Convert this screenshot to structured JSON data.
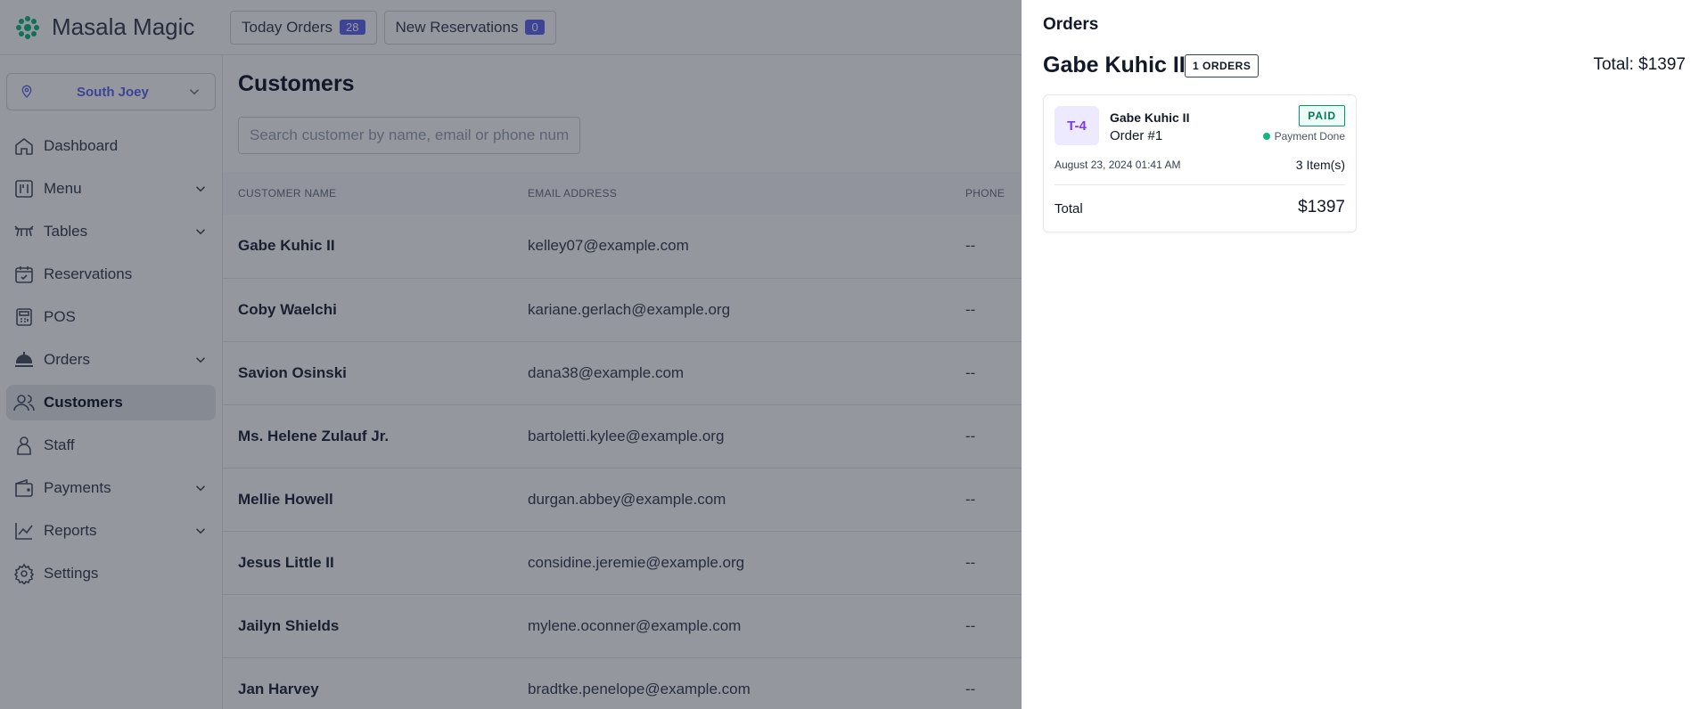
{
  "app": {
    "name": "Masala Magic"
  },
  "topbar": {
    "today_orders_label": "Today Orders",
    "today_orders_count": "28",
    "new_reservations_label": "New Reservations",
    "new_reservations_count": "0"
  },
  "sidebar": {
    "branch": "South Joey",
    "items": [
      {
        "label": "Dashboard",
        "icon": "home-icon"
      },
      {
        "label": "Menu",
        "icon": "menu-book-icon",
        "expandable": true
      },
      {
        "label": "Tables",
        "icon": "table-icon",
        "expandable": true
      },
      {
        "label": "Reservations",
        "icon": "calendar-check-icon"
      },
      {
        "label": "POS",
        "icon": "pos-icon"
      },
      {
        "label": "Orders",
        "icon": "cloche-icon",
        "expandable": true
      },
      {
        "label": "Customers",
        "icon": "users-icon",
        "active": true
      },
      {
        "label": "Staff",
        "icon": "user-icon"
      },
      {
        "label": "Payments",
        "icon": "wallet-icon",
        "expandable": true
      },
      {
        "label": "Reports",
        "icon": "chart-icon",
        "expandable": true
      },
      {
        "label": "Settings",
        "icon": "gear-icon"
      }
    ]
  },
  "main": {
    "title": "Customers",
    "search_placeholder": "Search customer by name, email or phone number",
    "columns": [
      "Customer Name",
      "Email Address",
      "Phone"
    ],
    "rows": [
      {
        "name": "Gabe Kuhic II",
        "email": "kelley07@example.com",
        "phone": "--"
      },
      {
        "name": "Coby Waelchi",
        "email": "kariane.gerlach@example.org",
        "phone": "--"
      },
      {
        "name": "Savion Osinski",
        "email": "dana38@example.com",
        "phone": "--"
      },
      {
        "name": "Ms. Helene Zulauf Jr.",
        "email": "bartoletti.kylee@example.org",
        "phone": "--"
      },
      {
        "name": "Mellie Howell",
        "email": "durgan.abbey@example.com",
        "phone": "--"
      },
      {
        "name": "Jesus Little II",
        "email": "considine.jeremie@example.org",
        "phone": "--"
      },
      {
        "name": "Jailyn Shields",
        "email": "mylene.oconner@example.com",
        "phone": "--"
      },
      {
        "name": "Jan Harvey",
        "email": "bradtke.penelope@example.com",
        "phone": "--"
      }
    ]
  },
  "drawer": {
    "title": "Orders",
    "customer_name": "Gabe Kuhic II",
    "orders_badge": "1 ORDERS",
    "total": "Total: $1397",
    "order": {
      "table": "T-4",
      "customer": "Gabe Kuhic II",
      "number": "Order #1",
      "status_badge": "PAID",
      "payment_status": "Payment Done",
      "date": "August 23, 2024 01:41 AM",
      "items": "3 Item(s)",
      "total_label": "Total",
      "total_value": "$1397"
    }
  },
  "colors": {
    "accent": "#6366f1",
    "paid": "#059669",
    "overlay": "#111827"
  }
}
